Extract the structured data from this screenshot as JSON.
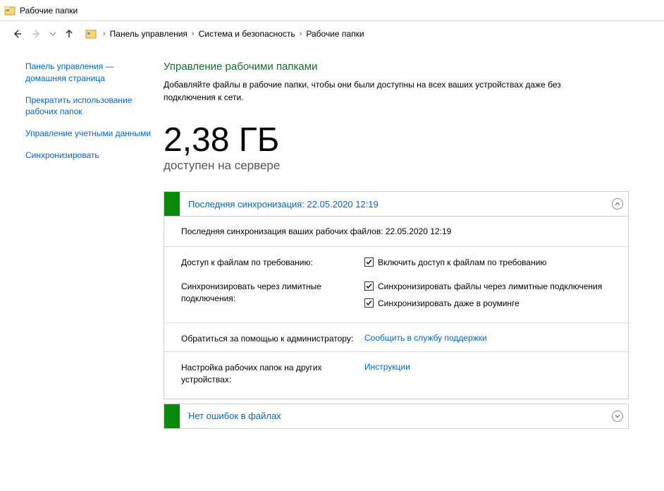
{
  "titlebar": {
    "title": "Рабочие папки"
  },
  "breadcrumb": {
    "items": [
      "Панель управления",
      "Система и безопасность",
      "Рабочие папки"
    ]
  },
  "sidebar": {
    "items": [
      "Панель управления — домашняя страница",
      "Прекратить использование рабочих папок",
      "Управление учетными данными",
      "Синхронизировать"
    ]
  },
  "main": {
    "title": "Управление рабочими папками",
    "description": "Добавляйте файлы в рабочие папки, чтобы они были доступны на всех ваших устройствах даже без подключения к сети.",
    "space_value": "2,38 ГБ",
    "space_caption": "доступен на сервере"
  },
  "panel_sync": {
    "header": "Последняя синхронизация: 22.05.2020 12:19",
    "body_line": "Последняя синхронизация ваших рабочих файлов: 22.05.2020 12:19",
    "rows": {
      "access_label": "Доступ к файлам по требованию:",
      "access_checkbox": "Включить доступ к файлам по требованию",
      "metered_label": "Синхронизировать через лимитные подключения:",
      "metered_checkbox1": "Синхронизировать файлы через лимитные подключения",
      "metered_checkbox2": "Синхронизировать даже в роуминге",
      "support_label": "Обратиться за помощью к администратору:",
      "support_link": "Сообщить в службу поддержки",
      "other_label": "Настройка рабочих папок на других устройствах:",
      "other_link": "Инструкции"
    }
  },
  "panel_errors": {
    "header": "Нет ошибок в файлах"
  }
}
